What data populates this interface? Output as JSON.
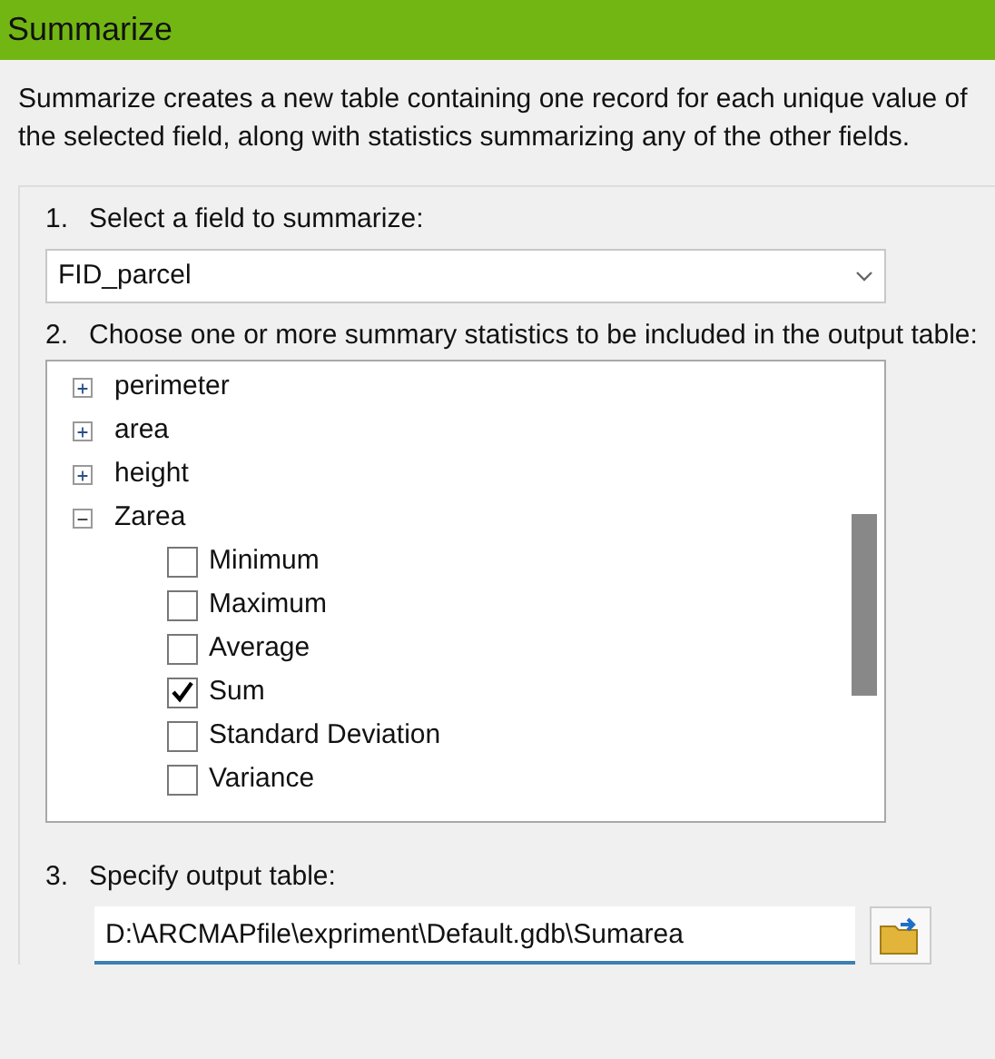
{
  "window": {
    "title": "Summarize"
  },
  "description": "Summarize creates a new table containing one record for each unique value of the selected field, along with statistics summarizing any of the other fields.",
  "steps": [
    {
      "number": "1.",
      "label": "Select a field to summarize:"
    },
    {
      "number": "2.",
      "label": "Choose one or more summary statistics to be included in the output table:"
    },
    {
      "number": "3.",
      "label": "Specify output table:"
    }
  ],
  "field_dropdown": {
    "value": "FID_parcel"
  },
  "tree": [
    {
      "label": "perimeter",
      "expanded": false
    },
    {
      "label": "area",
      "expanded": false
    },
    {
      "label": "height",
      "expanded": false
    },
    {
      "label": "Zarea",
      "expanded": true,
      "children": [
        {
          "label": "Minimum",
          "checked": false
        },
        {
          "label": "Maximum",
          "checked": false
        },
        {
          "label": "Average",
          "checked": false
        },
        {
          "label": "Sum",
          "checked": true
        },
        {
          "label": "Standard Deviation",
          "checked": false
        },
        {
          "label": "Variance",
          "checked": false
        }
      ]
    }
  ],
  "output_table": {
    "value": "D:\\ARCMAPfile\\expriment\\Default.gdb\\Sumarea"
  }
}
